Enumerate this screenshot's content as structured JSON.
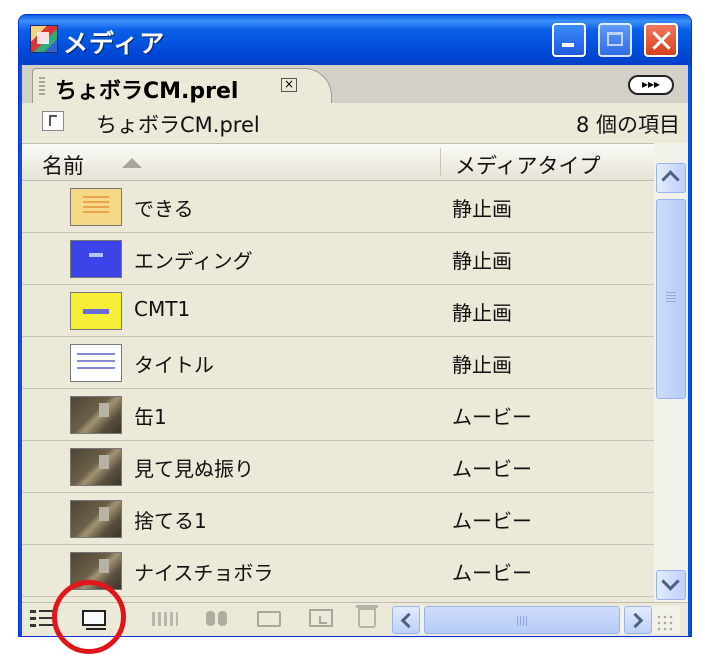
{
  "window": {
    "title": "メディア",
    "icon": "media-panel-app-icon",
    "controls": [
      "minimize",
      "maximize",
      "close"
    ]
  },
  "tab": {
    "label": "ちょボラCM.prel",
    "close_glyph": "×",
    "menu_glyph": "▸▸▸"
  },
  "path_bar": {
    "project_name": "ちょボラCM.prel",
    "item_count": "8 個の項目"
  },
  "columns": {
    "name": "名前",
    "media_type": "メディアタイプ"
  },
  "items": [
    {
      "name": "できる",
      "type": "静止画",
      "thumb": "yellow-document-thumbnail"
    },
    {
      "name": "エンディング",
      "type": "静止画",
      "thumb": "blue-title-thumbnail"
    },
    {
      "name": "CMT1",
      "type": "静止画",
      "thumb": "yellow-logo-thumbnail"
    },
    {
      "name": "タイトル",
      "type": "静止画",
      "thumb": "white-text-thumbnail"
    },
    {
      "name": "缶1",
      "type": "ムービー",
      "thumb": "video-frame-thumbnail"
    },
    {
      "name": "見て見ぬ振り",
      "type": "ムービー",
      "thumb": "video-frame-thumbnail"
    },
    {
      "name": "捨てる1",
      "type": "ムービー",
      "thumb": "video-frame-thumbnail"
    },
    {
      "name": "ナイスチョボラ",
      "type": "ムービー",
      "thumb": "video-frame-thumbnail"
    }
  ],
  "toolbar": {
    "buttons": [
      "list-view-icon",
      "icon-view-icon",
      "automate-to-sequence-icon",
      "find-icon",
      "new-bin-icon",
      "new-item-icon",
      "clear-icon"
    ]
  },
  "colors": {
    "titlebar": "#0a5fe8",
    "panel": "#ece9d8",
    "annotation": "#e0161c"
  }
}
